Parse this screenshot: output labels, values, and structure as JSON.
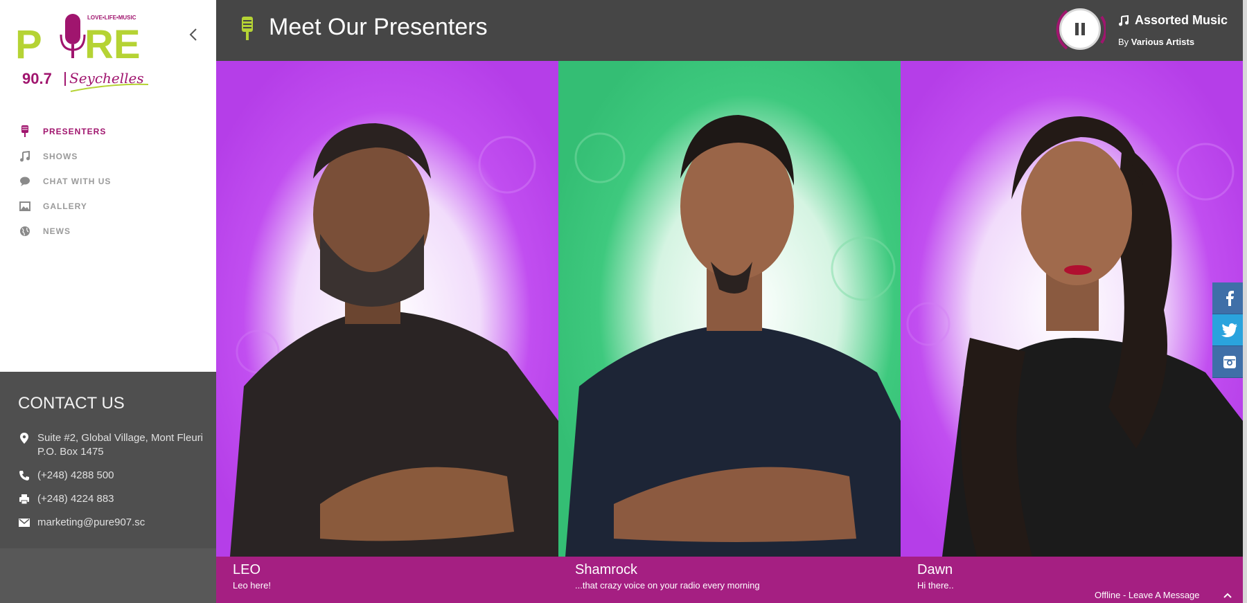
{
  "brand": {
    "tagline": "LOVE•LIFE•MUSIC",
    "name": "PURE",
    "frequency": "90.7",
    "location": "Seychelles",
    "colors": {
      "green": "#b5d334",
      "magenta": "#a0156e",
      "purple": "#c14ef0",
      "mint": "#3ec97e"
    }
  },
  "sidebar": {
    "nav": [
      {
        "label": "PRESENTERS",
        "icon": "microphone-icon",
        "active": true
      },
      {
        "label": "SHOWS",
        "icon": "music-note-icon"
      },
      {
        "label": "CHAT WITH US",
        "icon": "chat-icon"
      },
      {
        "label": "GALLERY",
        "icon": "image-icon"
      },
      {
        "label": "NEWS",
        "icon": "globe-icon"
      }
    ]
  },
  "contact": {
    "title": "CONTACT US",
    "address": "Suite #2, Global Village, Mont Fleuri P.O. Box 1475",
    "phone": "(+248) 4288 500",
    "fax": "(+248) 4224 883",
    "email": "marketing@pure907.sc"
  },
  "header": {
    "title": "Meet Our Presenters"
  },
  "player": {
    "track_title": "Assorted Music",
    "by_label": "By",
    "artist": "Various Artists",
    "state": "playing"
  },
  "presenters": [
    {
      "name": "LEO",
      "subtitle": "Leo here!",
      "bg": "#c14ef0"
    },
    {
      "name": "Shamrock",
      "subtitle": "...that crazy voice on your radio every morning",
      "bg": "#3ec97e"
    },
    {
      "name": "Dawn",
      "subtitle": "Hi there..",
      "bg": "#c14ef0"
    }
  ],
  "social": [
    "facebook-icon",
    "twitter-icon",
    "instagram-icon"
  ],
  "chat": {
    "label": "Offline - Leave A Message"
  }
}
